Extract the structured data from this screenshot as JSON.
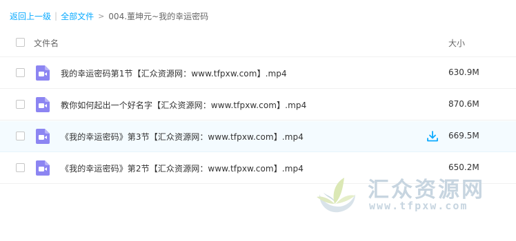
{
  "breadcrumb": {
    "back_label": "返回上一级",
    "separator": "|",
    "all_files_label": "全部文件",
    "arrow": ">",
    "current_label": "004.董坤元~我的幸运密码"
  },
  "table": {
    "headers": {
      "name": "文件名",
      "size": "大小"
    },
    "rows": [
      {
        "name": "我的幸运密码第1节【汇众资源网：www.tfpxw.com】.mp4",
        "size": "630.9M",
        "icon": "video-file-icon"
      },
      {
        "name": "教你如何起出一个好名字【汇众资源网：www.tfpxw.com】.mp4",
        "size": "870.6M",
        "icon": "video-file-icon"
      },
      {
        "name": "《我的幸运密码》第3节【汇众资源网：www.tfpxw.com】.mp4",
        "size": "669.5M",
        "icon": "video-file-icon",
        "hovered": true
      },
      {
        "name": "《我的幸运密码》第2节【汇众资源网：www.tfpxw.com】.mp4",
        "size": "650.2M",
        "icon": "video-file-icon"
      }
    ]
  },
  "watermark": {
    "title": "汇众资源网",
    "url": "www.tfpxw.com"
  },
  "colors": {
    "link": "#09AAFF",
    "video_icon": "#8C85F2",
    "hover_row": "#f4fbff",
    "download_icon": "#09AAFF"
  }
}
